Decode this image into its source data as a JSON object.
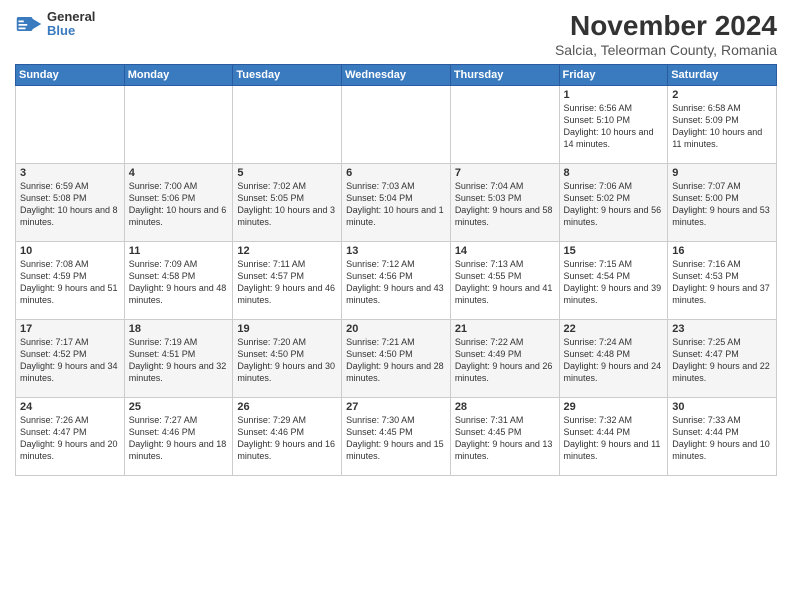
{
  "logo": {
    "general": "General",
    "blue": "Blue"
  },
  "header": {
    "month_title": "November 2024",
    "subtitle": "Salcia, Teleorman County, Romania"
  },
  "weekdays": [
    "Sunday",
    "Monday",
    "Tuesday",
    "Wednesday",
    "Thursday",
    "Friday",
    "Saturday"
  ],
  "weeks": [
    [
      {
        "day": "",
        "info": ""
      },
      {
        "day": "",
        "info": ""
      },
      {
        "day": "",
        "info": ""
      },
      {
        "day": "",
        "info": ""
      },
      {
        "day": "",
        "info": ""
      },
      {
        "day": "1",
        "info": "Sunrise: 6:56 AM\nSunset: 5:10 PM\nDaylight: 10 hours and 14 minutes."
      },
      {
        "day": "2",
        "info": "Sunrise: 6:58 AM\nSunset: 5:09 PM\nDaylight: 10 hours and 11 minutes."
      }
    ],
    [
      {
        "day": "3",
        "info": "Sunrise: 6:59 AM\nSunset: 5:08 PM\nDaylight: 10 hours and 8 minutes."
      },
      {
        "day": "4",
        "info": "Sunrise: 7:00 AM\nSunset: 5:06 PM\nDaylight: 10 hours and 6 minutes."
      },
      {
        "day": "5",
        "info": "Sunrise: 7:02 AM\nSunset: 5:05 PM\nDaylight: 10 hours and 3 minutes."
      },
      {
        "day": "6",
        "info": "Sunrise: 7:03 AM\nSunset: 5:04 PM\nDaylight: 10 hours and 1 minute."
      },
      {
        "day": "7",
        "info": "Sunrise: 7:04 AM\nSunset: 5:03 PM\nDaylight: 9 hours and 58 minutes."
      },
      {
        "day": "8",
        "info": "Sunrise: 7:06 AM\nSunset: 5:02 PM\nDaylight: 9 hours and 56 minutes."
      },
      {
        "day": "9",
        "info": "Sunrise: 7:07 AM\nSunset: 5:00 PM\nDaylight: 9 hours and 53 minutes."
      }
    ],
    [
      {
        "day": "10",
        "info": "Sunrise: 7:08 AM\nSunset: 4:59 PM\nDaylight: 9 hours and 51 minutes."
      },
      {
        "day": "11",
        "info": "Sunrise: 7:09 AM\nSunset: 4:58 PM\nDaylight: 9 hours and 48 minutes."
      },
      {
        "day": "12",
        "info": "Sunrise: 7:11 AM\nSunset: 4:57 PM\nDaylight: 9 hours and 46 minutes."
      },
      {
        "day": "13",
        "info": "Sunrise: 7:12 AM\nSunset: 4:56 PM\nDaylight: 9 hours and 43 minutes."
      },
      {
        "day": "14",
        "info": "Sunrise: 7:13 AM\nSunset: 4:55 PM\nDaylight: 9 hours and 41 minutes."
      },
      {
        "day": "15",
        "info": "Sunrise: 7:15 AM\nSunset: 4:54 PM\nDaylight: 9 hours and 39 minutes."
      },
      {
        "day": "16",
        "info": "Sunrise: 7:16 AM\nSunset: 4:53 PM\nDaylight: 9 hours and 37 minutes."
      }
    ],
    [
      {
        "day": "17",
        "info": "Sunrise: 7:17 AM\nSunset: 4:52 PM\nDaylight: 9 hours and 34 minutes."
      },
      {
        "day": "18",
        "info": "Sunrise: 7:19 AM\nSunset: 4:51 PM\nDaylight: 9 hours and 32 minutes."
      },
      {
        "day": "19",
        "info": "Sunrise: 7:20 AM\nSunset: 4:50 PM\nDaylight: 9 hours and 30 minutes."
      },
      {
        "day": "20",
        "info": "Sunrise: 7:21 AM\nSunset: 4:50 PM\nDaylight: 9 hours and 28 minutes."
      },
      {
        "day": "21",
        "info": "Sunrise: 7:22 AM\nSunset: 4:49 PM\nDaylight: 9 hours and 26 minutes."
      },
      {
        "day": "22",
        "info": "Sunrise: 7:24 AM\nSunset: 4:48 PM\nDaylight: 9 hours and 24 minutes."
      },
      {
        "day": "23",
        "info": "Sunrise: 7:25 AM\nSunset: 4:47 PM\nDaylight: 9 hours and 22 minutes."
      }
    ],
    [
      {
        "day": "24",
        "info": "Sunrise: 7:26 AM\nSunset: 4:47 PM\nDaylight: 9 hours and 20 minutes."
      },
      {
        "day": "25",
        "info": "Sunrise: 7:27 AM\nSunset: 4:46 PM\nDaylight: 9 hours and 18 minutes."
      },
      {
        "day": "26",
        "info": "Sunrise: 7:29 AM\nSunset: 4:46 PM\nDaylight: 9 hours and 16 minutes."
      },
      {
        "day": "27",
        "info": "Sunrise: 7:30 AM\nSunset: 4:45 PM\nDaylight: 9 hours and 15 minutes."
      },
      {
        "day": "28",
        "info": "Sunrise: 7:31 AM\nSunset: 4:45 PM\nDaylight: 9 hours and 13 minutes."
      },
      {
        "day": "29",
        "info": "Sunrise: 7:32 AM\nSunset: 4:44 PM\nDaylight: 9 hours and 11 minutes."
      },
      {
        "day": "30",
        "info": "Sunrise: 7:33 AM\nSunset: 4:44 PM\nDaylight: 9 hours and 10 minutes."
      }
    ]
  ]
}
